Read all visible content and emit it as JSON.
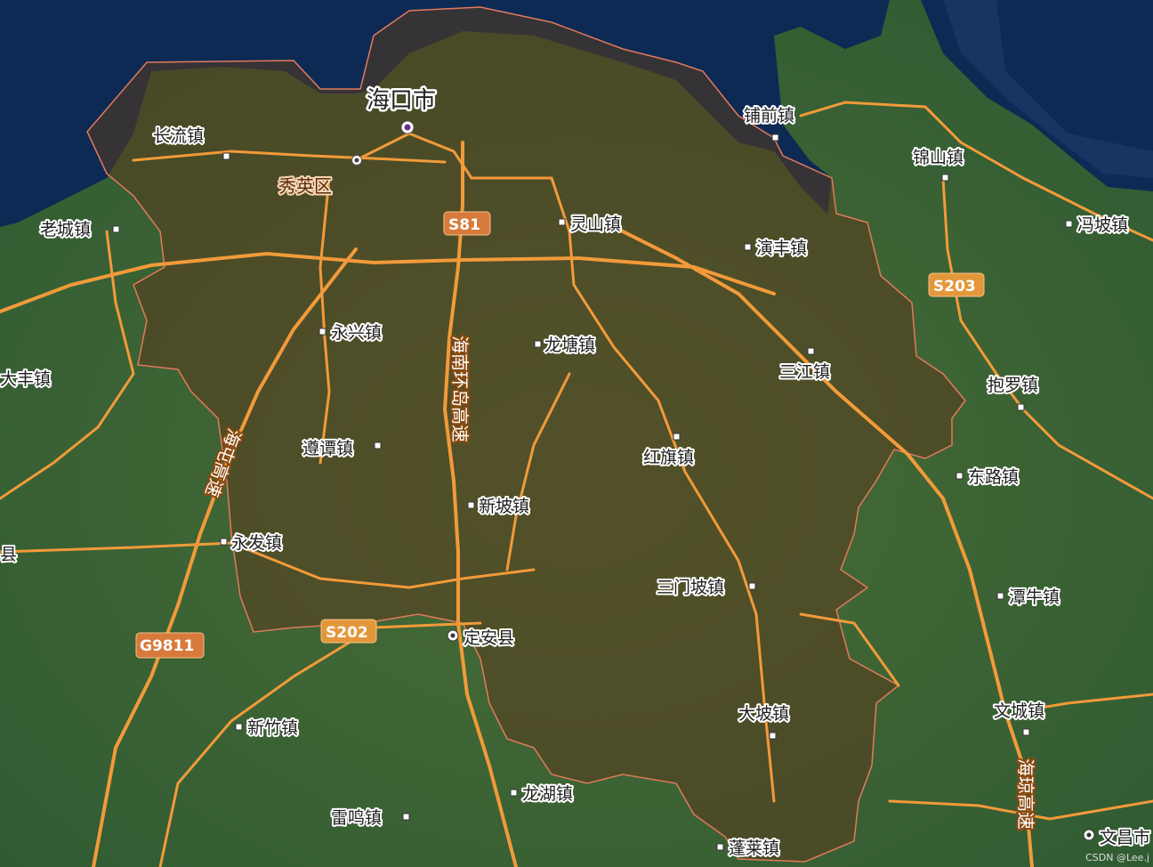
{
  "map": {
    "city": "海口市",
    "district": "秀英区",
    "county_seats": [
      "定安县",
      "文昌市"
    ],
    "towns": [
      "长流镇",
      "老城镇",
      "灵山镇",
      "演丰镇",
      "铺前镇",
      "锦山镇",
      "冯坡镇",
      "永兴镇",
      "龙塘镇",
      "三江镇",
      "抱罗镇",
      "大丰镇",
      "遵谭镇",
      "红旗镇",
      "东路镇",
      "新坡镇",
      "永发镇",
      "三门坡镇",
      "潭牛镇",
      "新竹镇",
      "大坡镇",
      "文城镇",
      "龙湖镇",
      "雷鸣镇",
      "蓬莱镇"
    ],
    "edge_fragments": [
      "县"
    ],
    "road_badges": [
      "S81",
      "S203",
      "S202",
      "G9811"
    ],
    "road_vertical_labels": {
      "huan_dao": "海南环岛高速",
      "left_gs": "海屯高速",
      "right_gs": "海琼高速"
    },
    "watermark": "CSDN @Lee.j",
    "colors": {
      "sea": "#0d2a55",
      "land": "#3f6a35",
      "overlay": "#5a3a1e",
      "boundary": "#e27a5a",
      "road": "#f29a3a",
      "badge": "#d77a3c"
    }
  }
}
